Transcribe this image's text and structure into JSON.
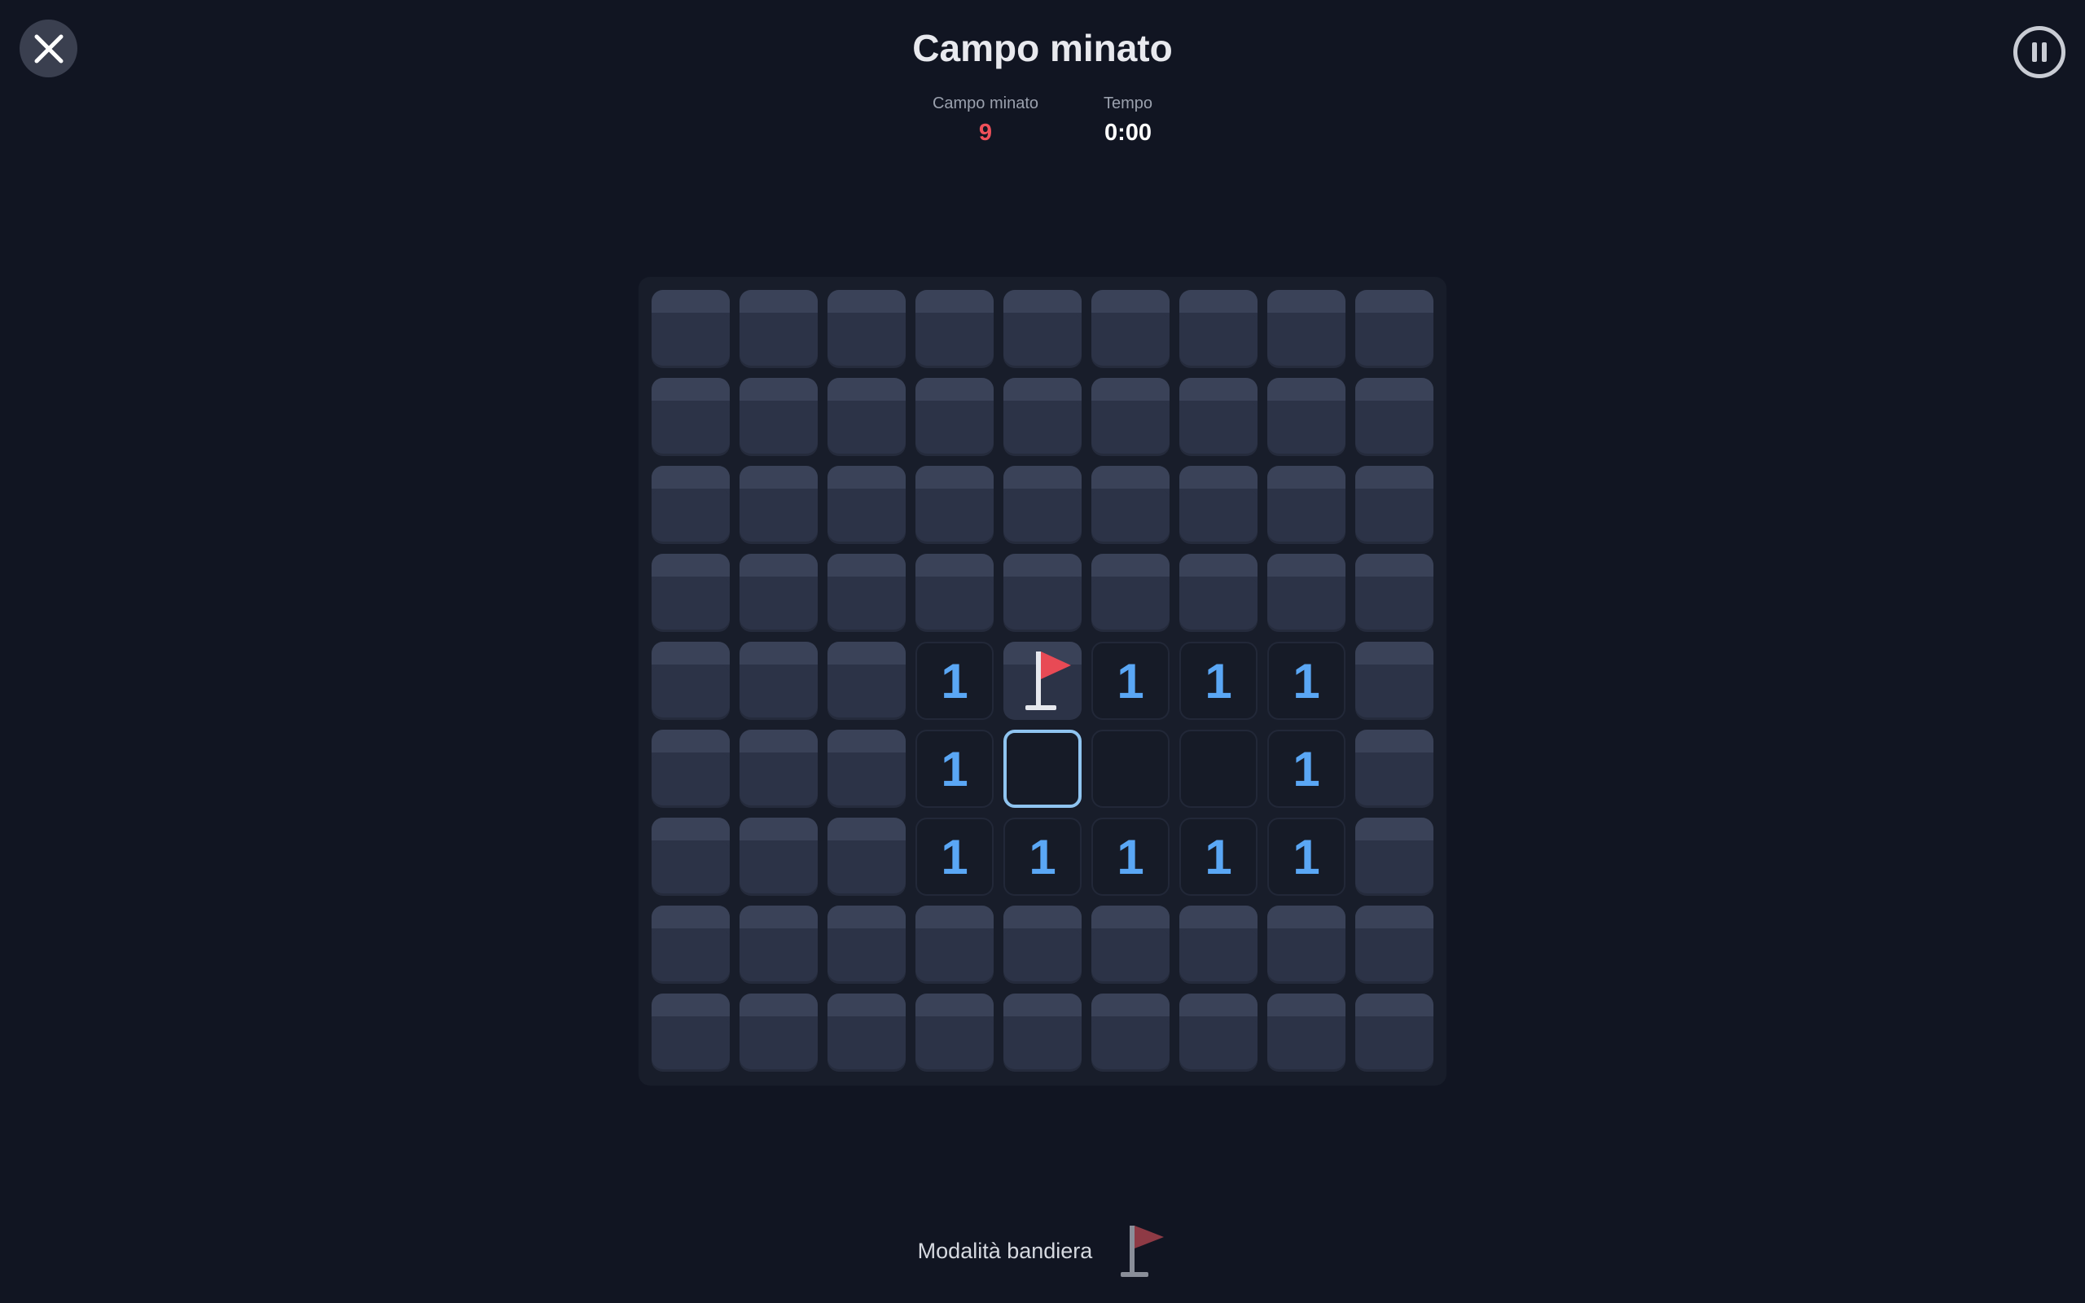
{
  "header": {
    "title": "Campo minato",
    "close_icon": "close-icon",
    "pause_icon": "pause-icon"
  },
  "stats": {
    "mines_label": "Campo minato",
    "mines_value": "9",
    "time_label": "Tempo",
    "time_value": "0:00"
  },
  "board": {
    "rows": 9,
    "cols": 9,
    "cells": [
      [
        "C",
        "C",
        "C",
        "C",
        "C",
        "C",
        "C",
        "C",
        "C"
      ],
      [
        "C",
        "C",
        "C",
        "C",
        "C",
        "C",
        "C",
        "C",
        "C"
      ],
      [
        "C",
        "C",
        "C",
        "C",
        "C",
        "C",
        "C",
        "C",
        "C"
      ],
      [
        "C",
        "C",
        "C",
        "C",
        "C",
        "C",
        "C",
        "C",
        "C"
      ],
      [
        "C",
        "C",
        "C",
        "1",
        "F",
        "1",
        "1",
        "1",
        "C"
      ],
      [
        "C",
        "C",
        "C",
        "1",
        "S",
        "E",
        "E",
        "1",
        "C"
      ],
      [
        "C",
        "C",
        "C",
        "1",
        "1",
        "1",
        "1",
        "1",
        "C"
      ],
      [
        "C",
        "C",
        "C",
        "C",
        "C",
        "C",
        "C",
        "C",
        "C"
      ],
      [
        "C",
        "C",
        "C",
        "C",
        "C",
        "C",
        "C",
        "C",
        "C"
      ]
    ]
  },
  "footer": {
    "flag_mode_label": "Modalità bandiera",
    "flag_mode_icon": "flag-icon"
  },
  "colors": {
    "background": "#111522",
    "mines_counter": "#f0505a",
    "number": "#5aa7f5",
    "flag": "#e84a55",
    "selection": "#8fc4f0"
  }
}
